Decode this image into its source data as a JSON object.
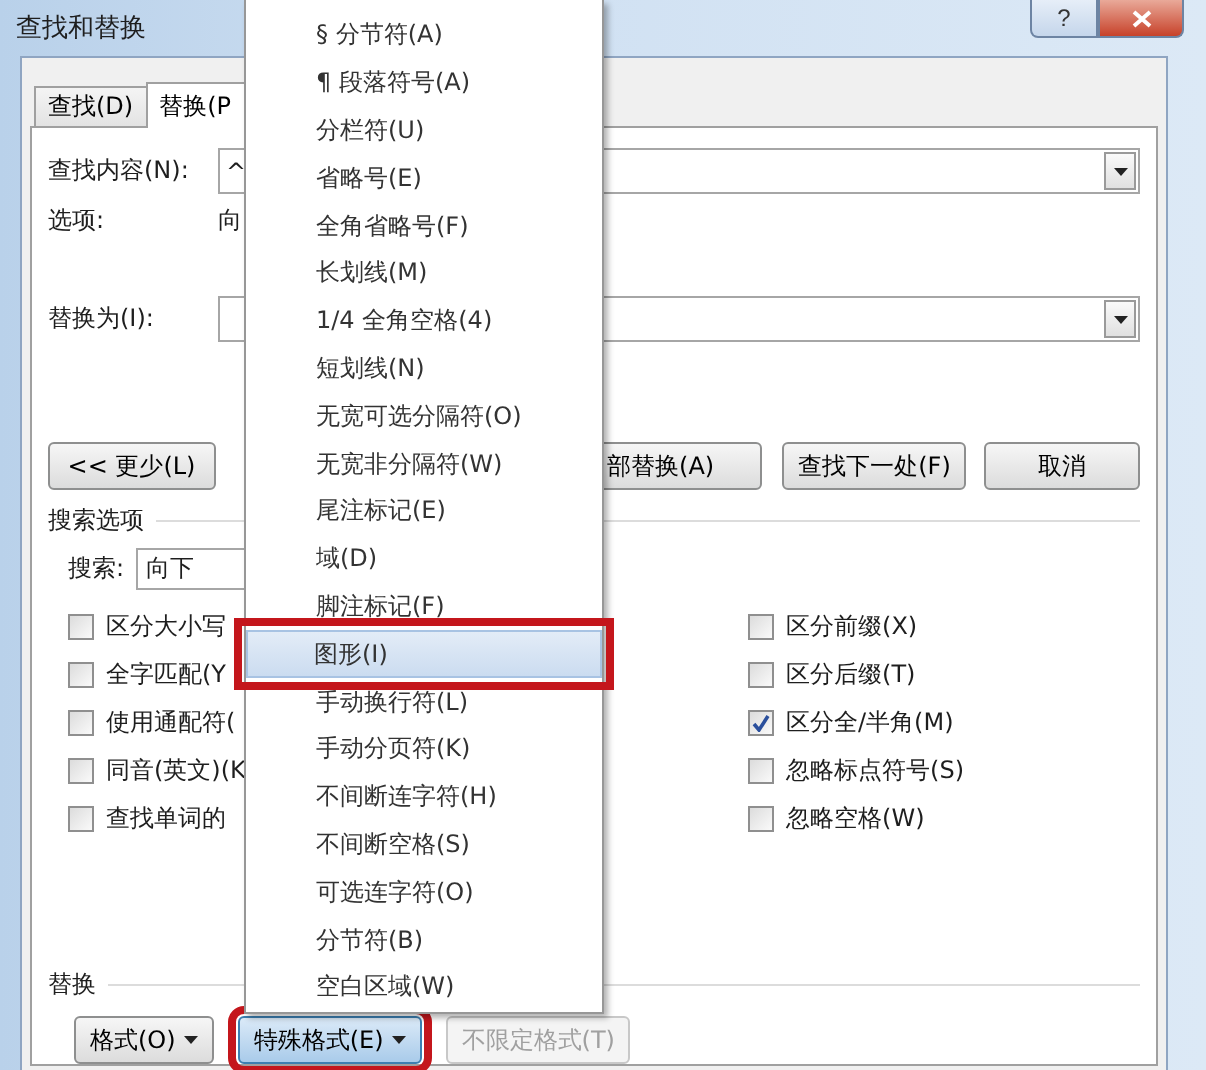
{
  "window": {
    "title": "查找和替换",
    "help": "?"
  },
  "tabs": [
    {
      "label": "查找(D)",
      "selected": false
    },
    {
      "label": "替换(P",
      "selected": true
    }
  ],
  "find": {
    "label": "查找内容(N):",
    "value": "^"
  },
  "options": {
    "label": "选项:",
    "value": "向"
  },
  "replace": {
    "label": "替换为(I):"
  },
  "buttons": [
    {
      "label": "<< 更少(L)"
    },
    {
      "label": "部替换(A)"
    },
    {
      "label": "查找下一处(F)"
    },
    {
      "label": "取消"
    }
  ],
  "search_options": {
    "heading": "搜索选项",
    "search_label": "搜索:",
    "search_value": "向下",
    "left_checks": [
      {
        "label": "区分大小写",
        "checked": false
      },
      {
        "label": "全字匹配(Y",
        "checked": false
      },
      {
        "label": "使用通配符(",
        "checked": false
      },
      {
        "label": "同音(英文)(K",
        "checked": false
      },
      {
        "label": "查找单词的",
        "checked": false
      }
    ],
    "right_checks": [
      {
        "label": "区分前缀(X)",
        "checked": false
      },
      {
        "label": "区分后缀(T)",
        "checked": false
      },
      {
        "label": "区分全/半角(M)",
        "checked": true
      },
      {
        "label": "忽略标点符号(S)",
        "checked": false
      },
      {
        "label": "忽略空格(W)",
        "checked": false
      }
    ]
  },
  "replace_section": {
    "heading": "替换",
    "buttons": [
      {
        "label": "格式(O)",
        "dropdown": true,
        "disabled": false,
        "outlined": false
      },
      {
        "label": "特殊格式(E)",
        "dropdown": true,
        "disabled": false,
        "outlined": true
      },
      {
        "label": "不限定格式(T)",
        "dropdown": false,
        "disabled": true,
        "outlined": false
      }
    ]
  },
  "menu": {
    "items": [
      {
        "label": "§ 分节符(A)",
        "selected": false,
        "outlined": false
      },
      {
        "label": "¶ 段落符号(A)",
        "selected": false,
        "outlined": false
      },
      {
        "label": "分栏符(U)",
        "selected": false,
        "outlined": false
      },
      {
        "label": "省略号(E)",
        "selected": false,
        "outlined": false
      },
      {
        "label": "全角省略号(F)",
        "selected": false,
        "outlined": false
      },
      {
        "label": "长划线(M)",
        "selected": false,
        "outlined": false
      },
      {
        "label": "1/4 全角空格(4)",
        "selected": false,
        "outlined": false
      },
      {
        "label": "短划线(N)",
        "selected": false,
        "outlined": false
      },
      {
        "label": "无宽可选分隔符(O)",
        "selected": false,
        "outlined": false
      },
      {
        "label": "无宽非分隔符(W)",
        "selected": false,
        "outlined": false
      },
      {
        "label": "尾注标记(E)",
        "selected": false,
        "outlined": false
      },
      {
        "label": "域(D)",
        "selected": false,
        "outlined": false
      },
      {
        "label": "脚注标记(F)",
        "selected": false,
        "outlined": false
      },
      {
        "label": "图形(I)",
        "selected": true,
        "outlined": true
      },
      {
        "label": "手动换行符(L)",
        "selected": false,
        "outlined": false
      },
      {
        "label": "手动分页符(K)",
        "selected": false,
        "outlined": false
      },
      {
        "label": "不间断连字符(H)",
        "selected": false,
        "outlined": false
      },
      {
        "label": "不间断空格(S)",
        "selected": false,
        "outlined": false
      },
      {
        "label": "可选连字符(O)",
        "selected": false,
        "outlined": false
      },
      {
        "label": "分节符(B)",
        "selected": false,
        "outlined": false
      },
      {
        "label": "空白区域(W)",
        "selected": false,
        "outlined": false
      }
    ]
  }
}
